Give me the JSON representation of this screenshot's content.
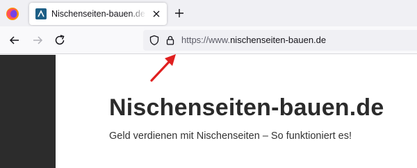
{
  "tabs": [
    {
      "title": "Nischenseiten-bauen.de | Geld verdienen mit Nischenseiten",
      "active": true
    }
  ],
  "urlbar": {
    "url_prefix": "https://www.",
    "url_domain": "nischenseiten-bauen.de"
  },
  "page": {
    "title": "Nischenseiten-bauen.de",
    "tagline": "Geld verdienen mit Nischenseiten – So funktioniert es!"
  },
  "icons": {
    "browser": "firefox-icon",
    "favicon": "site-favicon",
    "close": "close-icon",
    "new_tab": "plus-icon",
    "back": "back-arrow-icon",
    "forward": "forward-arrow-icon",
    "reload": "reload-icon",
    "tracking": "shield-icon",
    "security": "lock-icon"
  },
  "colors": {
    "annotation_arrow": "#e02020",
    "sidebar": "#2c2c2c",
    "favicon": "#1d5f86"
  }
}
